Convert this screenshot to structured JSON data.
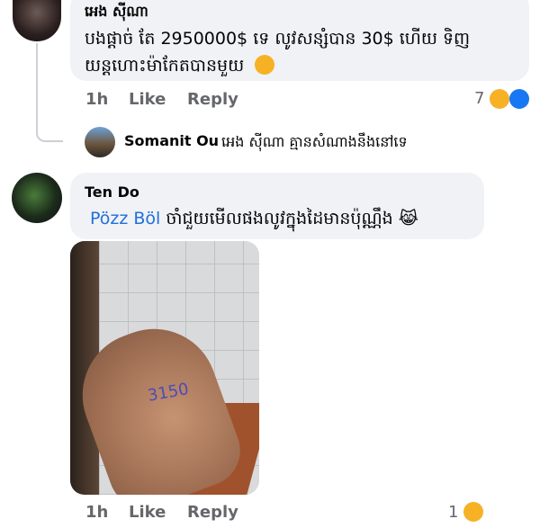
{
  "comments": [
    {
      "author": "អេង ស៊ីណា",
      "text_line1": "បងផ្តាច់ តែ 2950000$ ទេ លូវសន្សំបាន 30$ ហើយ ទិញ",
      "text_line2": "យន្តហោះម៉ាកែតបានមួយ",
      "emoji_text": "☺",
      "time": "1h",
      "like_label": "Like",
      "reply_label": "Reply",
      "reaction_count": "7",
      "reaction_icons": [
        "haha-icon",
        "like-icon"
      ]
    },
    {
      "author": "Somanit Ou",
      "text": "អេង ស៊ីណា គ្មានសំណាងនឹងនៅទេ"
    },
    {
      "author": "Ten Do",
      "mention": "Pözz Böl",
      "text": "ចាំជួយមើលផងលូវក្នុងដៃមានប៉ុណ្ណឹង",
      "emoji_text": "😹",
      "time": "1h",
      "like_label": "Like",
      "reply_label": "Reply",
      "reaction_count": "1",
      "reaction_icons": [
        "haha-icon"
      ]
    }
  ],
  "photo": {
    "alt": "photo of a hand with a handwritten number on the palm",
    "palm_text": "3150"
  },
  "colors": {
    "mention": "#216fdb",
    "muted": "#65676b",
    "bubble": "#f0f2f5",
    "like_blue": "#1877f2",
    "haha_yellow": "#f7b125"
  }
}
